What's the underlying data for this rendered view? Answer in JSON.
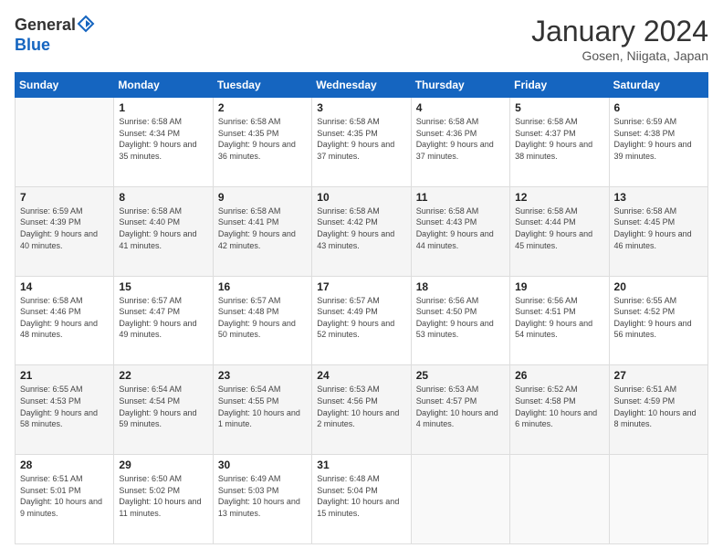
{
  "logo": {
    "general": "General",
    "blue": "Blue"
  },
  "header": {
    "month": "January 2024",
    "location": "Gosen, Niigata, Japan"
  },
  "weekdays": [
    "Sunday",
    "Monday",
    "Tuesday",
    "Wednesday",
    "Thursday",
    "Friday",
    "Saturday"
  ],
  "days": [
    {
      "date": 1,
      "weekday": 1,
      "sunrise": "6:58 AM",
      "sunset": "4:34 PM",
      "daylight": "9 hours and 35 minutes."
    },
    {
      "date": 2,
      "weekday": 2,
      "sunrise": "6:58 AM",
      "sunset": "4:35 PM",
      "daylight": "9 hours and 36 minutes."
    },
    {
      "date": 3,
      "weekday": 3,
      "sunrise": "6:58 AM",
      "sunset": "4:35 PM",
      "daylight": "9 hours and 37 minutes."
    },
    {
      "date": 4,
      "weekday": 4,
      "sunrise": "6:58 AM",
      "sunset": "4:36 PM",
      "daylight": "9 hours and 37 minutes."
    },
    {
      "date": 5,
      "weekday": 5,
      "sunrise": "6:58 AM",
      "sunset": "4:37 PM",
      "daylight": "9 hours and 38 minutes."
    },
    {
      "date": 6,
      "weekday": 6,
      "sunrise": "6:59 AM",
      "sunset": "4:38 PM",
      "daylight": "9 hours and 39 minutes."
    },
    {
      "date": 7,
      "weekday": 0,
      "sunrise": "6:59 AM",
      "sunset": "4:39 PM",
      "daylight": "9 hours and 40 minutes."
    },
    {
      "date": 8,
      "weekday": 1,
      "sunrise": "6:58 AM",
      "sunset": "4:40 PM",
      "daylight": "9 hours and 41 minutes."
    },
    {
      "date": 9,
      "weekday": 2,
      "sunrise": "6:58 AM",
      "sunset": "4:41 PM",
      "daylight": "9 hours and 42 minutes."
    },
    {
      "date": 10,
      "weekday": 3,
      "sunrise": "6:58 AM",
      "sunset": "4:42 PM",
      "daylight": "9 hours and 43 minutes."
    },
    {
      "date": 11,
      "weekday": 4,
      "sunrise": "6:58 AM",
      "sunset": "4:43 PM",
      "daylight": "9 hours and 44 minutes."
    },
    {
      "date": 12,
      "weekday": 5,
      "sunrise": "6:58 AM",
      "sunset": "4:44 PM",
      "daylight": "9 hours and 45 minutes."
    },
    {
      "date": 13,
      "weekday": 6,
      "sunrise": "6:58 AM",
      "sunset": "4:45 PM",
      "daylight": "9 hours and 46 minutes."
    },
    {
      "date": 14,
      "weekday": 0,
      "sunrise": "6:58 AM",
      "sunset": "4:46 PM",
      "daylight": "9 hours and 48 minutes."
    },
    {
      "date": 15,
      "weekday": 1,
      "sunrise": "6:57 AM",
      "sunset": "4:47 PM",
      "daylight": "9 hours and 49 minutes."
    },
    {
      "date": 16,
      "weekday": 2,
      "sunrise": "6:57 AM",
      "sunset": "4:48 PM",
      "daylight": "9 hours and 50 minutes."
    },
    {
      "date": 17,
      "weekday": 3,
      "sunrise": "6:57 AM",
      "sunset": "4:49 PM",
      "daylight": "9 hours and 52 minutes."
    },
    {
      "date": 18,
      "weekday": 4,
      "sunrise": "6:56 AM",
      "sunset": "4:50 PM",
      "daylight": "9 hours and 53 minutes."
    },
    {
      "date": 19,
      "weekday": 5,
      "sunrise": "6:56 AM",
      "sunset": "4:51 PM",
      "daylight": "9 hours and 54 minutes."
    },
    {
      "date": 20,
      "weekday": 6,
      "sunrise": "6:55 AM",
      "sunset": "4:52 PM",
      "daylight": "9 hours and 56 minutes."
    },
    {
      "date": 21,
      "weekday": 0,
      "sunrise": "6:55 AM",
      "sunset": "4:53 PM",
      "daylight": "9 hours and 58 minutes."
    },
    {
      "date": 22,
      "weekday": 1,
      "sunrise": "6:54 AM",
      "sunset": "4:54 PM",
      "daylight": "9 hours and 59 minutes."
    },
    {
      "date": 23,
      "weekday": 2,
      "sunrise": "6:54 AM",
      "sunset": "4:55 PM",
      "daylight": "10 hours and 1 minute."
    },
    {
      "date": 24,
      "weekday": 3,
      "sunrise": "6:53 AM",
      "sunset": "4:56 PM",
      "daylight": "10 hours and 2 minutes."
    },
    {
      "date": 25,
      "weekday": 4,
      "sunrise": "6:53 AM",
      "sunset": "4:57 PM",
      "daylight": "10 hours and 4 minutes."
    },
    {
      "date": 26,
      "weekday": 5,
      "sunrise": "6:52 AM",
      "sunset": "4:58 PM",
      "daylight": "10 hours and 6 minutes."
    },
    {
      "date": 27,
      "weekday": 6,
      "sunrise": "6:51 AM",
      "sunset": "4:59 PM",
      "daylight": "10 hours and 8 minutes."
    },
    {
      "date": 28,
      "weekday": 0,
      "sunrise": "6:51 AM",
      "sunset": "5:01 PM",
      "daylight": "10 hours and 9 minutes."
    },
    {
      "date": 29,
      "weekday": 1,
      "sunrise": "6:50 AM",
      "sunset": "5:02 PM",
      "daylight": "10 hours and 11 minutes."
    },
    {
      "date": 30,
      "weekday": 2,
      "sunrise": "6:49 AM",
      "sunset": "5:03 PM",
      "daylight": "10 hours and 13 minutes."
    },
    {
      "date": 31,
      "weekday": 3,
      "sunrise": "6:48 AM",
      "sunset": "5:04 PM",
      "daylight": "10 hours and 15 minutes."
    }
  ]
}
